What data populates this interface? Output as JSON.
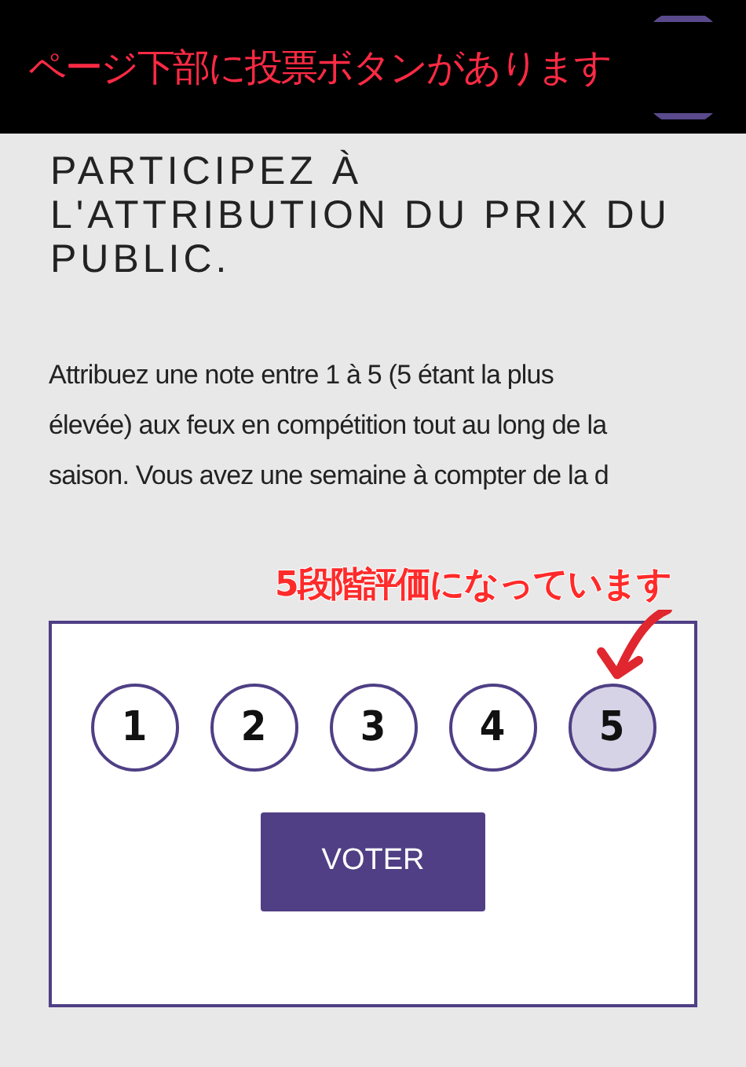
{
  "banner": {
    "text": "ページ下部に投票ボタンがあります"
  },
  "heading": "PARTICIPEZ À L'ATTRIBUTION DU PRIX DU PUBLIC.",
  "description": "Attribuez une note entre 1 à 5 (5 étant la plus élevée) aux feux en compétition tout au long de la saison. Vous avez une semaine à compter de la d",
  "annotation": {
    "text": "5段階評価になっています"
  },
  "rating": {
    "options": [
      {
        "label": "1",
        "selected": false
      },
      {
        "label": "2",
        "selected": false
      },
      {
        "label": "3",
        "selected": false
      },
      {
        "label": "4",
        "selected": false
      },
      {
        "label": "5",
        "selected": true
      }
    ]
  },
  "vote_button": "VOTER"
}
